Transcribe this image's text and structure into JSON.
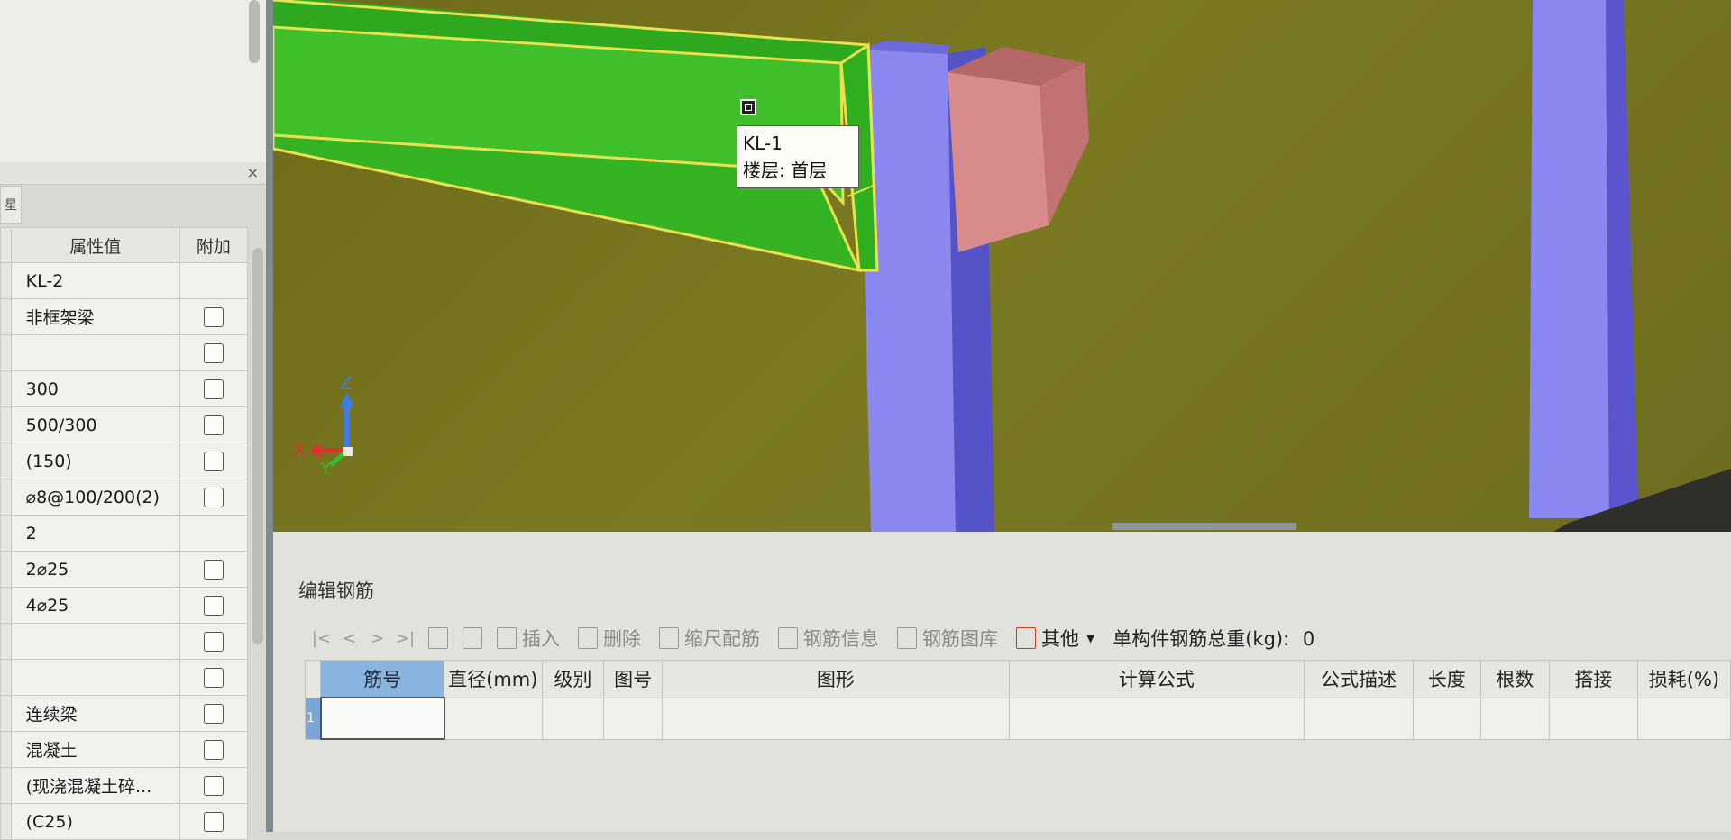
{
  "property_panel": {
    "close_icon": "×",
    "tab_label": "星",
    "headers": {
      "value": "属性值",
      "extra": "附加"
    },
    "rows": [
      {
        "value": "KL-2",
        "has_checkbox": false
      },
      {
        "value": "非框架梁",
        "has_checkbox": true
      },
      {
        "value": "",
        "has_checkbox": true
      },
      {
        "value": "300",
        "has_checkbox": true
      },
      {
        "value": "500/300",
        "has_checkbox": true
      },
      {
        "value": "(150)",
        "has_checkbox": true
      },
      {
        "value": "⌀8@100/200(2)",
        "has_checkbox": true
      },
      {
        "value": "2",
        "has_checkbox": false
      },
      {
        "value": "2⌀25",
        "has_checkbox": true
      },
      {
        "value": "4⌀25",
        "has_checkbox": true
      },
      {
        "value": "",
        "has_checkbox": true
      },
      {
        "value": "",
        "has_checkbox": true
      },
      {
        "value": "连续梁",
        "has_checkbox": true
      },
      {
        "value": "混凝土",
        "has_checkbox": true
      },
      {
        "value": "(现浇混凝土碎...",
        "has_checkbox": true
      },
      {
        "value": "(C25)",
        "has_checkbox": true
      }
    ]
  },
  "viewport": {
    "tooltip": {
      "name": "KL-1",
      "floor": "楼层: 首层"
    },
    "axis": {
      "z": "Z",
      "x": "X",
      "y": "Y"
    },
    "colors": {
      "beam": "#3fbf2a",
      "beam_outline": "#e8e050",
      "column": "#8a88f0",
      "column_side": "#5a55cc",
      "wall": "#d98a8a",
      "background": "#767420"
    }
  },
  "rebar_editor": {
    "title": "编辑钢筋",
    "toolbar": {
      "nav": [
        "|<",
        "<",
        ">",
        ">|"
      ],
      "insert": "插入",
      "delete": "删除",
      "scale": "缩尺配筋",
      "info": "钢筋信息",
      "library": "钢筋图库",
      "other": "其他",
      "total_weight_label": "单构件钢筋总重(kg):",
      "total_weight_value": "0"
    },
    "columns": [
      "筋号",
      "直径(mm)",
      "级别",
      "图号",
      "图形",
      "计算公式",
      "公式描述",
      "长度",
      "根数",
      "搭接",
      "损耗(%)"
    ],
    "rows": [
      {
        "index": "1"
      }
    ]
  }
}
